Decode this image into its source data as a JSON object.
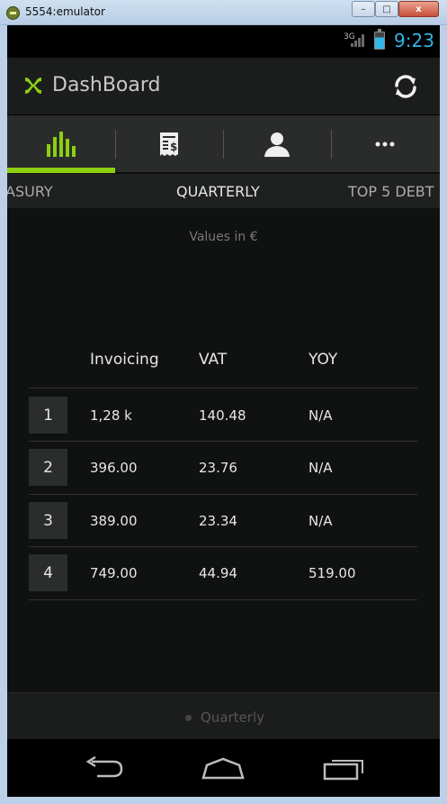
{
  "window": {
    "title": "5554:emulator",
    "min_label": "–",
    "max_label": "□",
    "close_label": "x"
  },
  "statusbar": {
    "network": "3G",
    "time": "9:23"
  },
  "actionbar": {
    "title": "DashBoard"
  },
  "tabs": [
    {
      "icon": "bar-chart-icon",
      "selected": true
    },
    {
      "icon": "invoice-icon"
    },
    {
      "icon": "person-icon"
    },
    {
      "icon": "overflow-icon"
    }
  ],
  "subtabs": {
    "left": "ASURY",
    "active": "QUARTERLY",
    "right": "TOP 5 DEBT"
  },
  "content": {
    "values_note": "Values in €",
    "columns": [
      "Invoicing",
      "VAT",
      "YOY"
    ],
    "rows": [
      {
        "num": "1",
        "invoicing": "1,28 k",
        "vat": "140.48",
        "yoy": "N/A"
      },
      {
        "num": "2",
        "invoicing": "396.00",
        "vat": "23.76",
        "yoy": "N/A"
      },
      {
        "num": "3",
        "invoicing": "389.00",
        "vat": "23.34",
        "yoy": "N/A"
      },
      {
        "num": "4",
        "invoicing": "749.00",
        "vat": "44.94",
        "yoy": "519.00"
      }
    ]
  },
  "footer": {
    "label": "Quarterly"
  },
  "colors": {
    "accent": "#8ccf10",
    "status_clock": "#33b5e5"
  }
}
